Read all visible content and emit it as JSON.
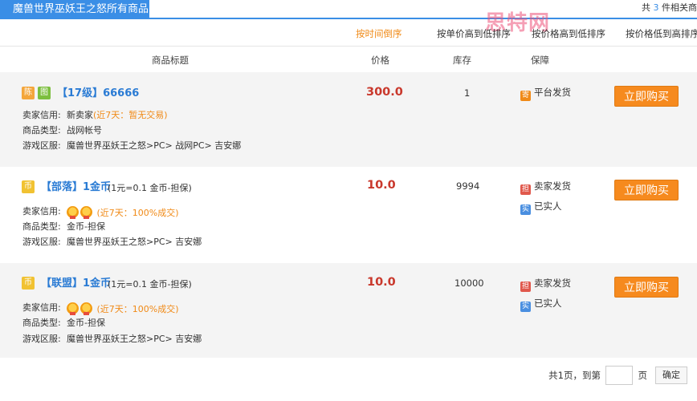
{
  "header": {
    "title": "魔兽世界巫妖王之怒所有商品",
    "total_prefix": "共",
    "total_count": "3",
    "total_suffix": "件相关商"
  },
  "watermark": "思特网",
  "sort": [
    {
      "label": "按时间倒序",
      "active": true
    },
    {
      "label": "按单价高到低排序",
      "active": false
    },
    {
      "label": "按价格高到低排序",
      "active": false
    },
    {
      "label": "按价格低到高排序",
      "active": false
    }
  ],
  "columns": {
    "title": "商品标题",
    "price": "价格",
    "stock": "库存",
    "guarantee": "保障"
  },
  "labels": {
    "seller_credit": "卖家信用:",
    "item_type": "商品类型:",
    "server": "游戏区服:",
    "buy": "立即购买"
  },
  "items": [
    {
      "badges": [
        "陈",
        "图"
      ],
      "title": "【17级】66666",
      "subtitle": "",
      "seller": "新卖家",
      "recent": "(近7天：暂无交易)",
      "type": "战网帐号",
      "server": "魔兽世界巫妖王之怒>PC> 战网PC> 吉安娜",
      "price": "300.0",
      "stock": "1",
      "guarantee": [
        "平台发货"
      ],
      "guarantee_icons": [
        "寄"
      ]
    },
    {
      "badges": [
        "币"
      ],
      "title": "【部落】1金币",
      "subtitle": "(1元=0.1 金币-担保)",
      "seller": "",
      "recent": "(近7天：100%成交)",
      "type": "金币-担保",
      "server": "魔兽世界巫妖王之怒>PC> 吉安娜",
      "price": "10.0",
      "stock": "9994",
      "guarantee": [
        "卖家发货",
        "已实人"
      ],
      "guarantee_icons": [
        "担",
        "实"
      ]
    },
    {
      "badges": [
        "币"
      ],
      "title": "【联盟】1金币",
      "subtitle": "(1元=0.1 金币-担保)",
      "seller": "",
      "recent": "(近7天：100%成交)",
      "type": "金币-担保",
      "server": "魔兽世界巫妖王之怒>PC> 吉安娜",
      "price": "10.0",
      "stock": "10000",
      "guarantee": [
        "卖家发货",
        "已实人"
      ],
      "guarantee_icons": [
        "担",
        "实"
      ]
    }
  ],
  "pager": {
    "summary": "共1页，到第",
    "page_unit": "页",
    "confirm": "确定",
    "page_value": ""
  }
}
